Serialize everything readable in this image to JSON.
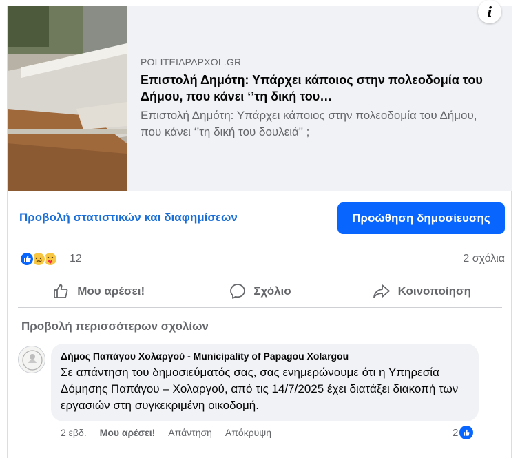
{
  "link_preview": {
    "domain": "POLITEIAPAPXOL.GR",
    "headline": "Επιστολή Δημότη: Υπάρχει κάποιος στην πολεοδομία του Δήμου, που κάνει ‘’τη δική του…",
    "description": "Επιστολή Δημότη: Υπάρχει κάποιος στην πολεοδομία του Δήμου, που κάνει ‘’τη δική του δουλειά\" ;",
    "info_icon": "info-icon"
  },
  "promo": {
    "stats_link": "Προβολή στατιστικών και διαφημίσεων",
    "boost_button": "Προώθηση δημοσίευσης"
  },
  "summary": {
    "reactions": [
      "like",
      "sad",
      "care"
    ],
    "reaction_count": "12",
    "comment_count": "2 σχόλια"
  },
  "actions": {
    "like": "Μου αρέσει!",
    "comment": "Σχόλιο",
    "share": "Κοινοποίηση"
  },
  "comments_section": {
    "view_more": "Προβολή περισσότερων σχολίων",
    "comment": {
      "author": "Δήμος Παπάγου Χολαργού - Municipality of Papagou Xolargou",
      "text": "Σε απάντηση του δημοσιεύματός σας, σας ενημερώνουμε ότι η Υπηρεσία Δόμησης Παπάγου – Χολαργού, από τις 14/7/2025 έχει διατάξει διακοπή των εργασιών στη συγκεκριμένη οικοδομή.",
      "time": "2 εβδ.",
      "like": "Μου αρέσει!",
      "reply": "Απάντηση",
      "hide": "Απόκρυψη",
      "like_count": "2"
    }
  },
  "colors": {
    "primary": "#0866ff",
    "link": "#1a6ed8",
    "secondary_text": "#65676b",
    "bubble": "#f0f2f5"
  }
}
